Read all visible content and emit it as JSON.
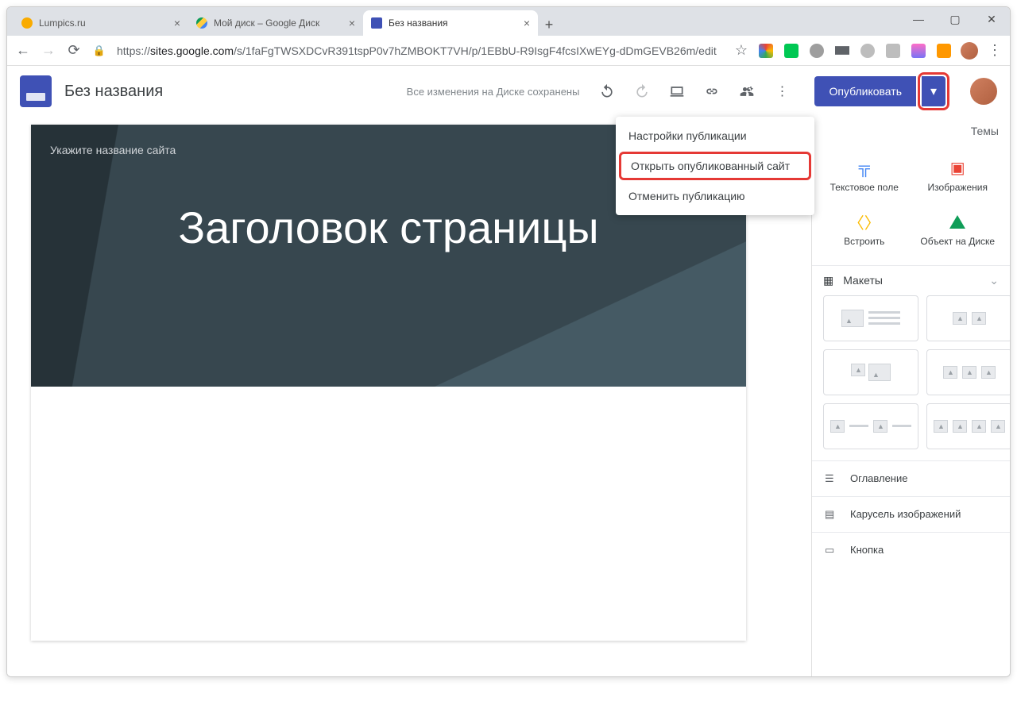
{
  "tabs": [
    {
      "label": "Lumpics.ru",
      "favicon": "#f9ab00"
    },
    {
      "label": "Мой диск – Google Диск",
      "favicon": "drive"
    },
    {
      "label": "Без названия",
      "favicon": "sites",
      "active": true
    }
  ],
  "url": {
    "protocol": "https://",
    "host": "sites.google.com",
    "path": "/s/1faFgTWSXDCvR391tspP0v7hZMBOKT7VH/p/1EBbU-R9IsgF4fcsIXwEYg-dDmGEVB26m/edit"
  },
  "app": {
    "doc_title": "Без названия",
    "save_status": "Все изменения на Диске сохранены",
    "publish_label": "Опубликовать"
  },
  "hero": {
    "site_name_placeholder": "Укажите название сайта",
    "page_title": "Заголовок страницы"
  },
  "dropdown": {
    "items": [
      "Настройки публикации",
      "Открыть опубликованный сайт",
      "Отменить публикацию"
    ]
  },
  "sidebar": {
    "tab_themes": "Темы",
    "insert": {
      "textbox": "Текстовое поле",
      "images": "Изображения",
      "embed": "Встроить",
      "drive": "Объект на Диске"
    },
    "layouts_label": "Макеты",
    "rows": {
      "toc": "Оглавление",
      "carousel": "Карусель изображений",
      "button": "Кнопка"
    }
  }
}
